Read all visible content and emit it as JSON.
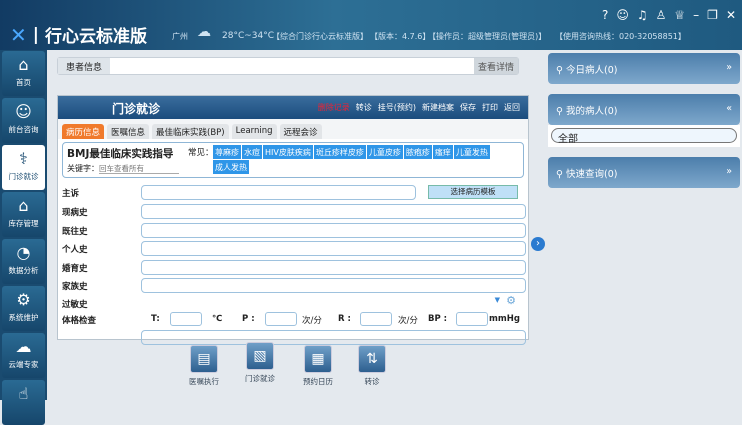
{
  "header": {
    "app_title": "行心云标准版",
    "city": "广州",
    "temp": "28°C~34°C",
    "edition": "【综合门诊行心云标准版】",
    "version": "【版本：4.7.6】",
    "operator": "【操作员：超级管理员(管理员)】",
    "hotline": "【使用咨询热线：020-32058851】"
  },
  "sidebar": {
    "items": [
      {
        "label": "首页",
        "icon": "home-icon"
      },
      {
        "label": "前台咨询",
        "icon": "receptionist-icon"
      },
      {
        "label": "门诊就诊",
        "icon": "doctor-icon"
      },
      {
        "label": "库存管理",
        "icon": "warehouse-icon"
      },
      {
        "label": "数据分析",
        "icon": "pie-chart-icon"
      },
      {
        "label": "系统维护",
        "icon": "gear-icon"
      },
      {
        "label": "云端专家",
        "icon": "cloud-icon"
      },
      {
        "label": "",
        "icon": "hand-pointer-icon"
      }
    ]
  },
  "patient": {
    "label": "患者信息",
    "details_button": "查看详情"
  },
  "panel": {
    "title": "门诊就诊",
    "tools": [
      "删除记录",
      "转诊",
      "挂号(预约)",
      "新建档案",
      "保存",
      "打印",
      "返回"
    ],
    "tabs": [
      "病历信息",
      "医嘱信息",
      "最佳临床实践(BP)",
      "Learning",
      "远程会诊"
    ],
    "bmj": {
      "title": "BMJ最佳临床实践指导",
      "keyword_label": "关键字：",
      "keyword_placeholder": "回车查看所有",
      "common_label": "常见：",
      "chips": [
        "荨麻疹",
        "水痘",
        "HIV皮肤疾病",
        "斑丘疹样皮疹",
        "儿童皮疹",
        "脓疱疹",
        "瘙痒",
        "儿童发热",
        "成人发热"
      ]
    },
    "fields": [
      "主诉",
      "现病史",
      "既往史",
      "个人史",
      "婚育史",
      "家族史",
      "过敏史",
      "体格检查"
    ],
    "template_button": "选择病历模板",
    "vitals": {
      "t": "T:",
      "t_unit": "℃",
      "p": "P :",
      "p_unit": "次/分",
      "r": "R :",
      "r_unit": "次/分",
      "bp": "BP :",
      "bp_unit": "mmHg"
    }
  },
  "right": {
    "today": "今日病人(0)",
    "mine": "我的病人(0)",
    "filter": "全部",
    "quick": "快速查询(0)"
  },
  "bottom": [
    {
      "label": "医嘱执行",
      "icon": "order-icon"
    },
    {
      "label": "门诊就诊",
      "icon": "clinic-icon"
    },
    {
      "label": "预约日历",
      "icon": "calendar-icon"
    },
    {
      "label": "转诊",
      "icon": "transfer-icon"
    }
  ]
}
